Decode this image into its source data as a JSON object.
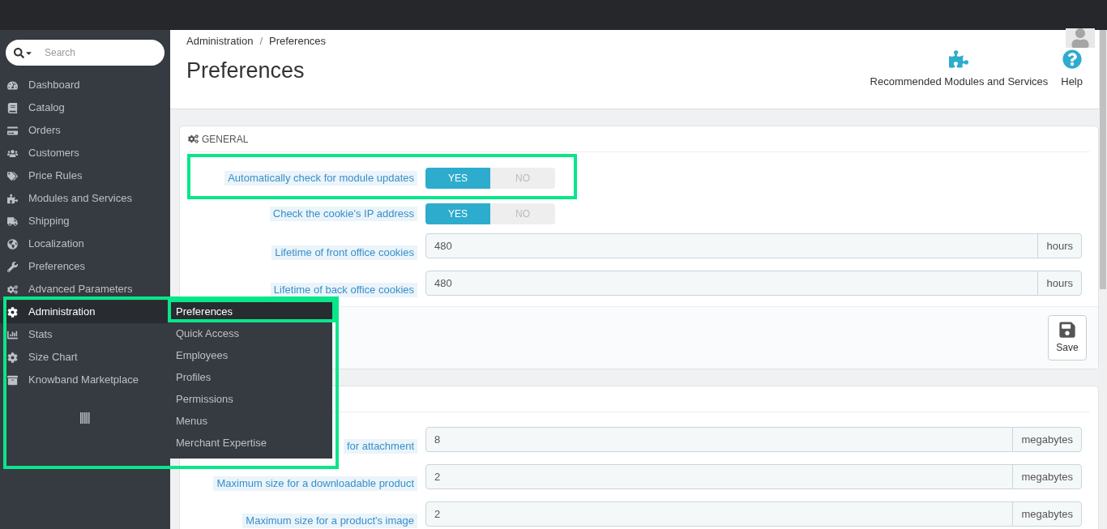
{
  "sidebar": {
    "search": {
      "placeholder": "Search"
    },
    "items": [
      {
        "label": "Dashboard",
        "selected": false
      },
      {
        "label": "Catalog",
        "selected": false
      },
      {
        "label": "Orders",
        "selected": false
      },
      {
        "label": "Customers",
        "selected": false
      },
      {
        "label": "Price Rules",
        "selected": false
      },
      {
        "label": "Modules and Services",
        "selected": false
      },
      {
        "label": "Shipping",
        "selected": false
      },
      {
        "label": "Localization",
        "selected": false
      },
      {
        "label": "Preferences",
        "selected": false
      },
      {
        "label": "Advanced Parameters",
        "selected": false
      },
      {
        "label": "Administration",
        "selected": true
      },
      {
        "label": "Stats",
        "selected": false
      },
      {
        "label": "Size Chart",
        "selected": false
      },
      {
        "label": "Knowband Marketplace",
        "selected": false
      }
    ],
    "submenu": [
      {
        "label": "Preferences",
        "selected": true
      },
      {
        "label": "Quick Access",
        "selected": false
      },
      {
        "label": "Employees",
        "selected": false
      },
      {
        "label": "Profiles",
        "selected": false
      },
      {
        "label": "Permissions",
        "selected": false
      },
      {
        "label": "Menus",
        "selected": false
      },
      {
        "label": "Merchant Expertise",
        "selected": false
      }
    ]
  },
  "header": {
    "breadcrumb": [
      "Administration",
      "/",
      "Preferences"
    ],
    "title": "Preferences",
    "toolbar": [
      "Recommended Modules and Services",
      "Help"
    ]
  },
  "panels": [
    {
      "title": "GENERAL",
      "save": "Save",
      "fields": [
        {
          "kind": "switch",
          "label": "Automatically check for module updates",
          "options": [
            {
              "label": "YES",
              "selected": true
            },
            {
              "label": "NO",
              "selected": false
            }
          ]
        },
        {
          "kind": "switch",
          "label": "Check the cookie's IP address",
          "options": [
            {
              "label": "YES",
              "selected": true
            },
            {
              "label": "NO",
              "selected": false
            }
          ]
        },
        {
          "kind": "input",
          "label": "Lifetime of front office cookies",
          "value": "480",
          "unit": "hours"
        },
        {
          "kind": "input",
          "label": "Lifetime of back office cookies",
          "value": "480",
          "unit": "hours"
        }
      ]
    },
    {
      "fields": [
        {
          "kind": "input",
          "label": "for attachment",
          "value": "8",
          "unit": "megabytes"
        },
        {
          "kind": "input",
          "label": "Maximum size for a downloadable product",
          "value": "2",
          "unit": "megabytes"
        },
        {
          "kind": "input",
          "label": "Maximum size for a product's image",
          "value": "2",
          "unit": "megabytes"
        }
      ]
    }
  ]
}
